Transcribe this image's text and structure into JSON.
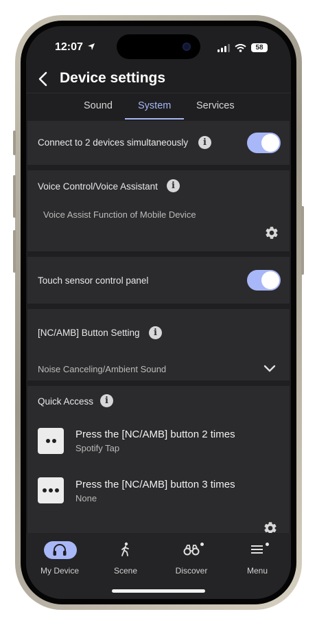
{
  "status": {
    "time": "12:07",
    "battery": "58"
  },
  "header": {
    "title": "Device settings"
  },
  "tabs": [
    "Sound",
    "System",
    "Services"
  ],
  "active_tab": "System",
  "settings": {
    "connect_two": {
      "label": "Connect to 2 devices simultaneously",
      "enabled": true
    },
    "voice_control": {
      "label": "Voice Control/Voice Assistant",
      "value": "Voice Assist Function of Mobile Device"
    },
    "touch_sensor": {
      "label": "Touch sensor control panel",
      "enabled": true
    },
    "nc_amb": {
      "label": "[NC/AMB] Button Setting",
      "value": "Noise Canceling/Ambient Sound"
    },
    "quick_access": {
      "label": "Quick Access",
      "items": [
        {
          "title": "Press the [NC/AMB] button 2 times",
          "value": "Spotify Tap",
          "dots": 2
        },
        {
          "title": "Press the [NC/AMB] button 3 times",
          "value": "None",
          "dots": 3
        }
      ]
    }
  },
  "bottom_nav": [
    {
      "label": "My Device",
      "icon": "headphones-icon",
      "active": true
    },
    {
      "label": "Scene",
      "icon": "walking-person-icon"
    },
    {
      "label": "Discover",
      "icon": "binoculars-icon",
      "badge": true
    },
    {
      "label": "Menu",
      "icon": "menu-icon",
      "badge": true
    }
  ],
  "colors": {
    "accent": "#a8b7f7",
    "background": "#1f1f21",
    "card": "#2b2b2d"
  }
}
